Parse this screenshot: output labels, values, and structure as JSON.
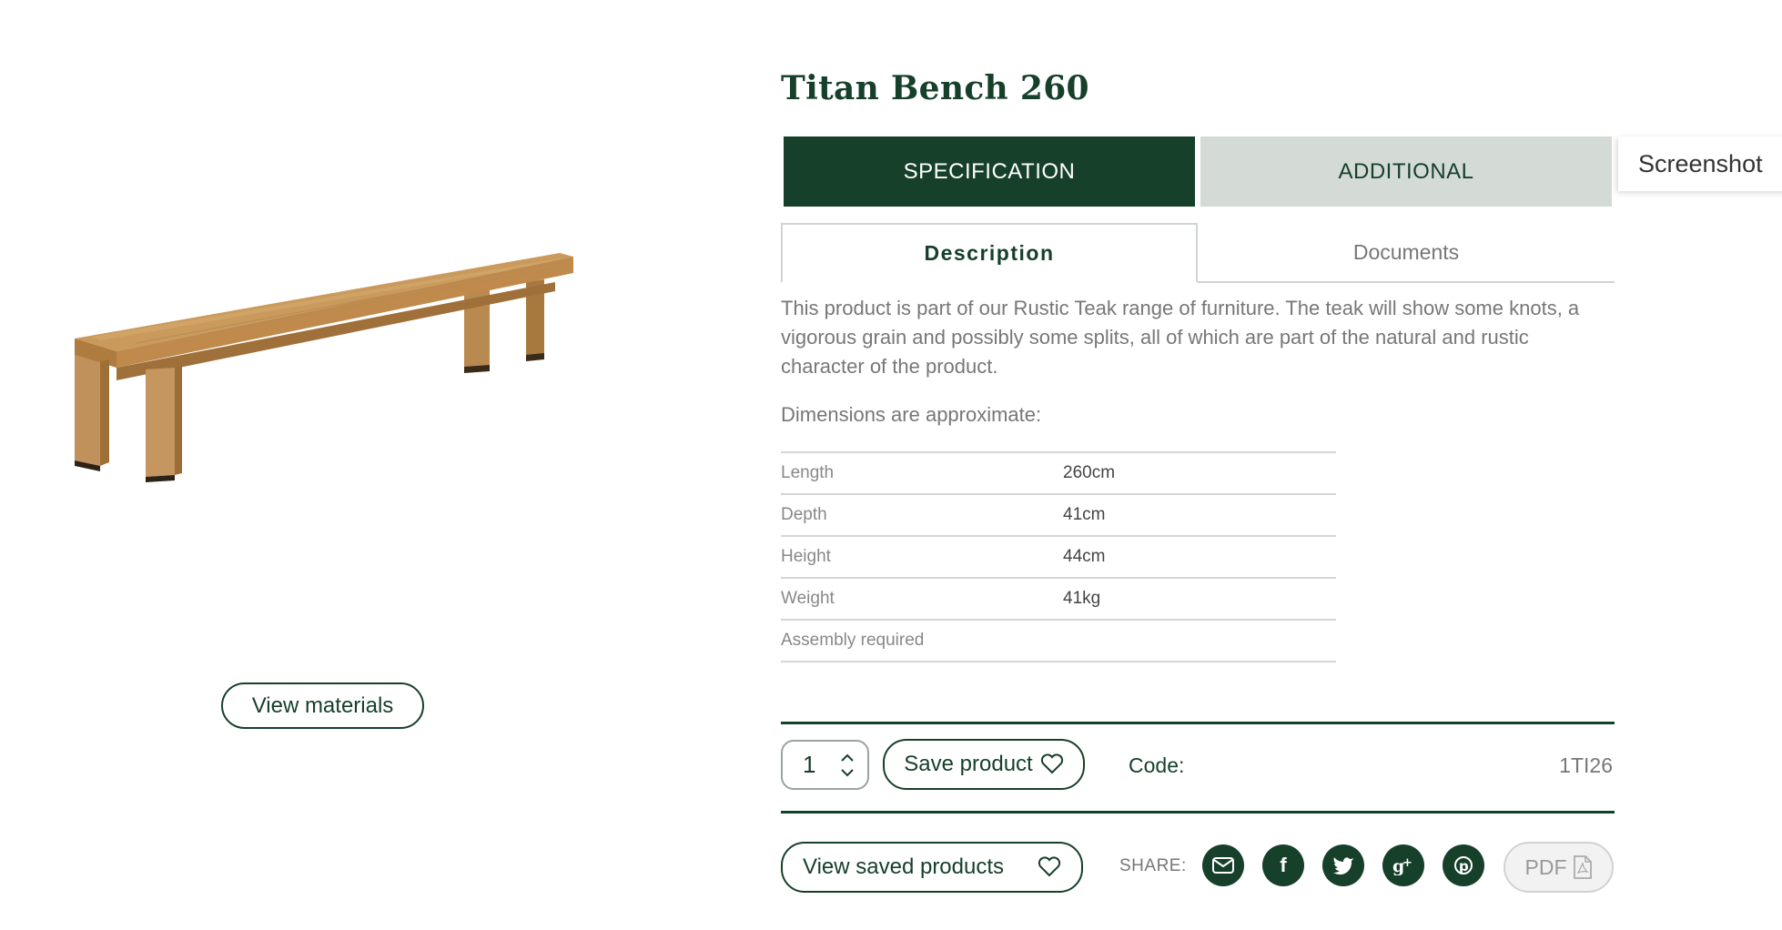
{
  "product": {
    "title": "Titan Bench 260",
    "view_materials_label": "View materials"
  },
  "tabs": {
    "specification": "SPECIFICATION",
    "additional": "ADDITIONAL"
  },
  "screenshot_tag": "Screenshot",
  "subtabs": {
    "description": "Description",
    "documents": "Documents"
  },
  "description": {
    "text": "This product is part of our Rustic Teak range of furniture. The teak will show some knots, a vigorous grain and possibly some splits, all of which are part of the natural and rustic character of the product.",
    "dimensions_heading": "Dimensions are approximate:"
  },
  "specs": [
    {
      "label": "Length",
      "value": "260cm"
    },
    {
      "label": "Depth",
      "value": "41cm"
    },
    {
      "label": "Height",
      "value": "44cm"
    },
    {
      "label": "Weight",
      "value": "41kg"
    },
    {
      "label": "Assembly required",
      "value": ""
    }
  ],
  "purchase": {
    "quantity": "1",
    "save_label": "Save product",
    "code_label": "Code:",
    "code_value": "1TI26"
  },
  "share": {
    "saved_label": "View saved products",
    "share_label": "SHARE:",
    "pdf_label": "PDF",
    "icons": [
      "email-icon",
      "facebook-icon",
      "twitter-icon",
      "google-plus-icon",
      "pinterest-icon"
    ]
  },
  "colors": {
    "brand_green": "#16402a",
    "tab_inactive": "#d4dbd6",
    "text_gray": "#777777"
  }
}
